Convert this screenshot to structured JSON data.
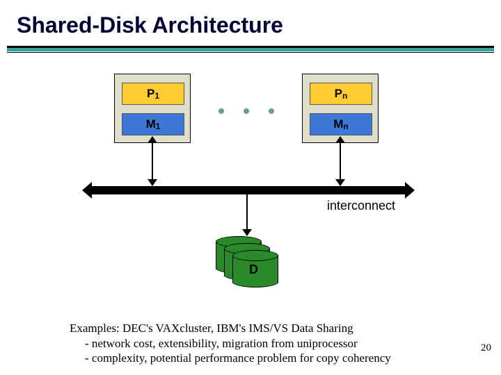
{
  "title": "Shared-Disk Architecture",
  "groups": {
    "left": {
      "p_label": "P",
      "p_sub": "1",
      "m_label": "M",
      "m_sub": "1"
    },
    "right": {
      "p_label": "P",
      "p_sub": "n",
      "m_label": "M",
      "m_sub": "n"
    }
  },
  "interconnect_label": "interconnect",
  "disk_label": "D",
  "examples": {
    "line1": "Examples: DEC's VAXcluster, IBM's IMS/VS Data Sharing",
    "bullets": [
      "-  network cost, extensibility, migration from uniprocessor",
      "-  complexity, potential performance problem for copy coherency"
    ]
  },
  "slide_number": "20",
  "chart_data": {
    "type": "diagram",
    "title": "Shared-Disk Architecture",
    "nodes": [
      {
        "id": "group1",
        "kind": "processing-node",
        "contains": [
          "P1",
          "M1"
        ]
      },
      {
        "id": "groupN",
        "kind": "processing-node",
        "contains": [
          "Pn",
          "Mn"
        ]
      },
      {
        "id": "ellipsis",
        "kind": "repetition-indicator"
      },
      {
        "id": "interconnect",
        "kind": "bus",
        "label": "interconnect"
      },
      {
        "id": "D",
        "kind": "shared-disk-stack",
        "label": "D"
      }
    ],
    "edges": [
      {
        "from": "group1",
        "to": "interconnect",
        "bidirectional": true
      },
      {
        "from": "groupN",
        "to": "interconnect",
        "bidirectional": true
      },
      {
        "from": "interconnect",
        "to": "D",
        "bidirectional": true
      }
    ],
    "annotations": [
      "Examples: DEC's VAXcluster, IBM's IMS/VS Data Sharing",
      "network cost, extensibility, migration from uniprocessor",
      "complexity, potential performance problem for copy coherency"
    ]
  }
}
